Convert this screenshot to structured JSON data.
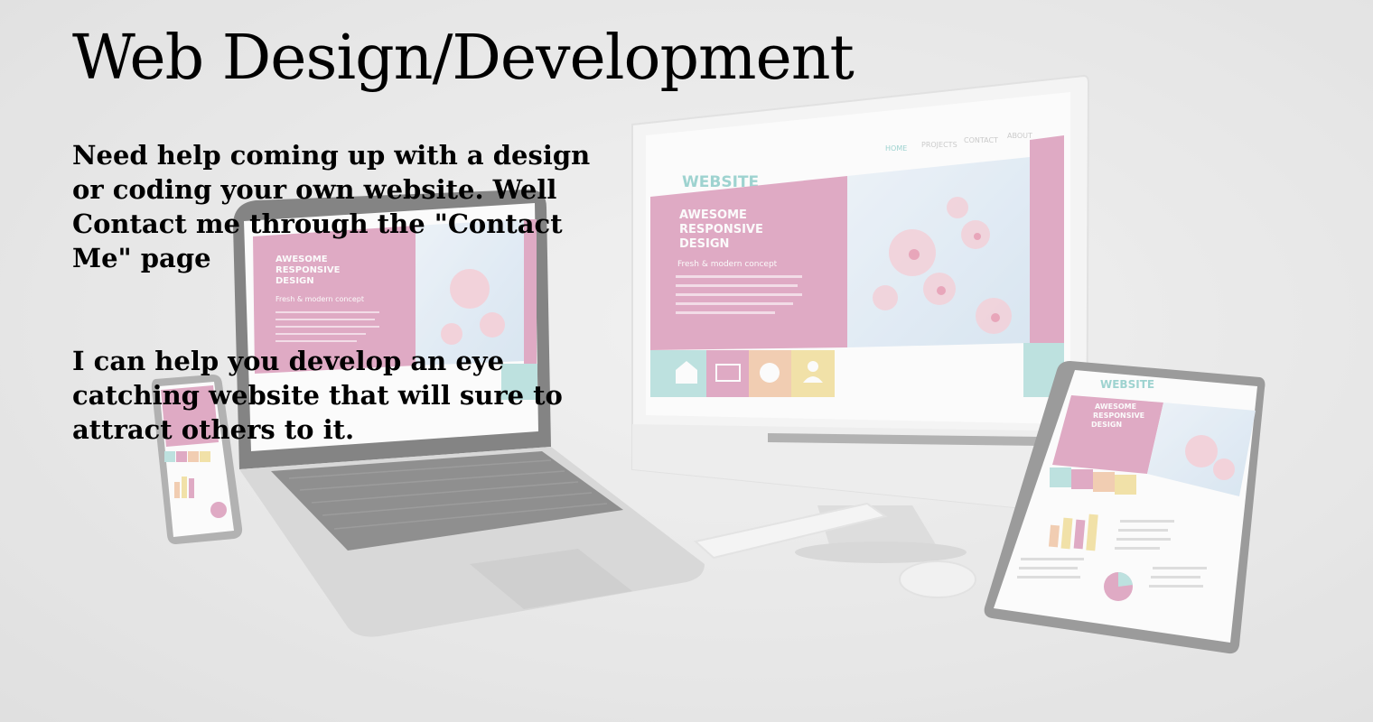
{
  "hero": {
    "title": "Web Design/Development",
    "paragraphs": [
      "Need help coming up with a design or coding your own website. Well Contact me through the \"Contact Me\" page",
      "I can help you develop an eye catching website that will sure to attract others to it."
    ]
  },
  "mockup": {
    "nav": [
      "HOME",
      "PROJECTS",
      "CONTACT",
      "ABOUT"
    ],
    "brand": "WEBSITE",
    "headline": [
      "AWESOME",
      "RESPONSIVE",
      "DESIGN"
    ],
    "tagline": "Fresh & modern concept",
    "colors": {
      "pink": "#d98fb3",
      "teal": "#a9dcd8",
      "peach": "#f2c09a",
      "yellow": "#f1dc8c",
      "sky": "#dbe9f4",
      "blossom": "#f3c6d2"
    },
    "icons": [
      "home-icon",
      "mail-icon",
      "globe-icon",
      "person-icon"
    ]
  }
}
